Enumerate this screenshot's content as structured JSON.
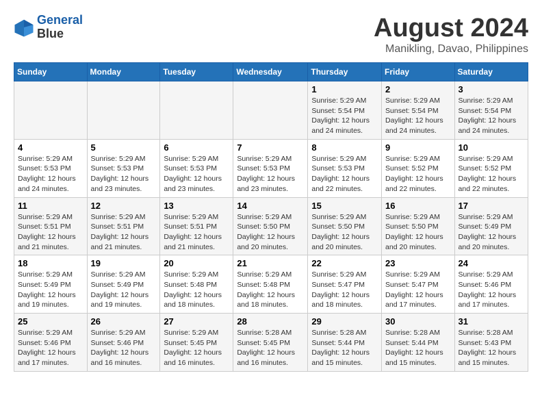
{
  "header": {
    "logo_line1": "General",
    "logo_line2": "Blue",
    "title": "August 2024",
    "subtitle": "Manikling, Davao, Philippines"
  },
  "weekdays": [
    "Sunday",
    "Monday",
    "Tuesday",
    "Wednesday",
    "Thursday",
    "Friday",
    "Saturday"
  ],
  "weeks": [
    [
      {
        "day": "",
        "info": ""
      },
      {
        "day": "",
        "info": ""
      },
      {
        "day": "",
        "info": ""
      },
      {
        "day": "",
        "info": ""
      },
      {
        "day": "1",
        "info": "Sunrise: 5:29 AM\nSunset: 5:54 PM\nDaylight: 12 hours\nand 24 minutes."
      },
      {
        "day": "2",
        "info": "Sunrise: 5:29 AM\nSunset: 5:54 PM\nDaylight: 12 hours\nand 24 minutes."
      },
      {
        "day": "3",
        "info": "Sunrise: 5:29 AM\nSunset: 5:54 PM\nDaylight: 12 hours\nand 24 minutes."
      }
    ],
    [
      {
        "day": "4",
        "info": "Sunrise: 5:29 AM\nSunset: 5:53 PM\nDaylight: 12 hours\nand 24 minutes."
      },
      {
        "day": "5",
        "info": "Sunrise: 5:29 AM\nSunset: 5:53 PM\nDaylight: 12 hours\nand 23 minutes."
      },
      {
        "day": "6",
        "info": "Sunrise: 5:29 AM\nSunset: 5:53 PM\nDaylight: 12 hours\nand 23 minutes."
      },
      {
        "day": "7",
        "info": "Sunrise: 5:29 AM\nSunset: 5:53 PM\nDaylight: 12 hours\nand 23 minutes."
      },
      {
        "day": "8",
        "info": "Sunrise: 5:29 AM\nSunset: 5:53 PM\nDaylight: 12 hours\nand 22 minutes."
      },
      {
        "day": "9",
        "info": "Sunrise: 5:29 AM\nSunset: 5:52 PM\nDaylight: 12 hours\nand 22 minutes."
      },
      {
        "day": "10",
        "info": "Sunrise: 5:29 AM\nSunset: 5:52 PM\nDaylight: 12 hours\nand 22 minutes."
      }
    ],
    [
      {
        "day": "11",
        "info": "Sunrise: 5:29 AM\nSunset: 5:51 PM\nDaylight: 12 hours\nand 21 minutes."
      },
      {
        "day": "12",
        "info": "Sunrise: 5:29 AM\nSunset: 5:51 PM\nDaylight: 12 hours\nand 21 minutes."
      },
      {
        "day": "13",
        "info": "Sunrise: 5:29 AM\nSunset: 5:51 PM\nDaylight: 12 hours\nand 21 minutes."
      },
      {
        "day": "14",
        "info": "Sunrise: 5:29 AM\nSunset: 5:50 PM\nDaylight: 12 hours\nand 20 minutes."
      },
      {
        "day": "15",
        "info": "Sunrise: 5:29 AM\nSunset: 5:50 PM\nDaylight: 12 hours\nand 20 minutes."
      },
      {
        "day": "16",
        "info": "Sunrise: 5:29 AM\nSunset: 5:50 PM\nDaylight: 12 hours\nand 20 minutes."
      },
      {
        "day": "17",
        "info": "Sunrise: 5:29 AM\nSunset: 5:49 PM\nDaylight: 12 hours\nand 20 minutes."
      }
    ],
    [
      {
        "day": "18",
        "info": "Sunrise: 5:29 AM\nSunset: 5:49 PM\nDaylight: 12 hours\nand 19 minutes."
      },
      {
        "day": "19",
        "info": "Sunrise: 5:29 AM\nSunset: 5:49 PM\nDaylight: 12 hours\nand 19 minutes."
      },
      {
        "day": "20",
        "info": "Sunrise: 5:29 AM\nSunset: 5:48 PM\nDaylight: 12 hours\nand 18 minutes."
      },
      {
        "day": "21",
        "info": "Sunrise: 5:29 AM\nSunset: 5:48 PM\nDaylight: 12 hours\nand 18 minutes."
      },
      {
        "day": "22",
        "info": "Sunrise: 5:29 AM\nSunset: 5:47 PM\nDaylight: 12 hours\nand 18 minutes."
      },
      {
        "day": "23",
        "info": "Sunrise: 5:29 AM\nSunset: 5:47 PM\nDaylight: 12 hours\nand 17 minutes."
      },
      {
        "day": "24",
        "info": "Sunrise: 5:29 AM\nSunset: 5:46 PM\nDaylight: 12 hours\nand 17 minutes."
      }
    ],
    [
      {
        "day": "25",
        "info": "Sunrise: 5:29 AM\nSunset: 5:46 PM\nDaylight: 12 hours\nand 17 minutes."
      },
      {
        "day": "26",
        "info": "Sunrise: 5:29 AM\nSunset: 5:46 PM\nDaylight: 12 hours\nand 16 minutes."
      },
      {
        "day": "27",
        "info": "Sunrise: 5:29 AM\nSunset: 5:45 PM\nDaylight: 12 hours\nand 16 minutes."
      },
      {
        "day": "28",
        "info": "Sunrise: 5:28 AM\nSunset: 5:45 PM\nDaylight: 12 hours\nand 16 minutes."
      },
      {
        "day": "29",
        "info": "Sunrise: 5:28 AM\nSunset: 5:44 PM\nDaylight: 12 hours\nand 15 minutes."
      },
      {
        "day": "30",
        "info": "Sunrise: 5:28 AM\nSunset: 5:44 PM\nDaylight: 12 hours\nand 15 minutes."
      },
      {
        "day": "31",
        "info": "Sunrise: 5:28 AM\nSunset: 5:43 PM\nDaylight: 12 hours\nand 15 minutes."
      }
    ]
  ]
}
